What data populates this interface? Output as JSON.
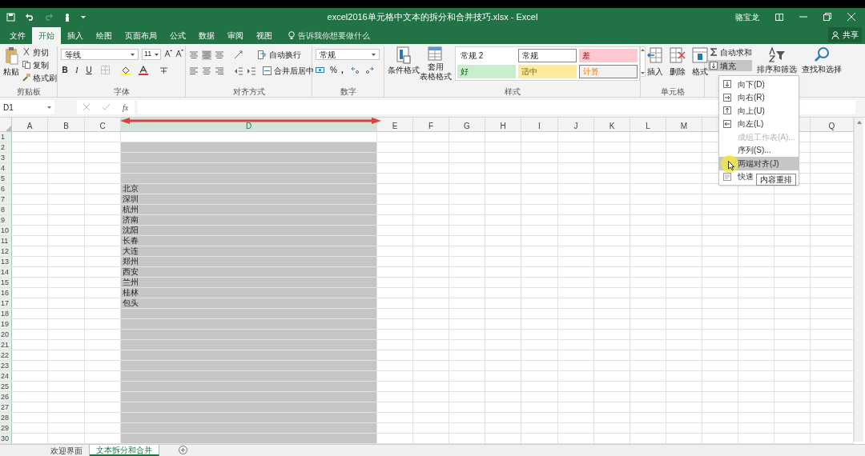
{
  "window": {
    "title": "excel2016单元格中文本的拆分和合并技巧.xlsx - Excel",
    "user": "骆宝龙"
  },
  "tabs": [
    {
      "label": "文件",
      "selected": false
    },
    {
      "label": "开始",
      "selected": true
    },
    {
      "label": "插入",
      "selected": false
    },
    {
      "label": "绘图",
      "selected": false
    },
    {
      "label": "页面布局",
      "selected": false
    },
    {
      "label": "公式",
      "selected": false
    },
    {
      "label": "数据",
      "selected": false
    },
    {
      "label": "审阅",
      "selected": false
    },
    {
      "label": "视图",
      "selected": false
    }
  ],
  "tell_me": {
    "placeholder": "告诉我你想要做什么"
  },
  "share_button": "共享",
  "ribbon": {
    "clipboard": {
      "paste": "粘贴",
      "cut": "剪切",
      "copy": "复制",
      "format_painter": "格式刷",
      "label": "剪贴板"
    },
    "font": {
      "font_name": "等线",
      "font_size": "11",
      "bold": "B",
      "italic": "I",
      "underline": "U",
      "label": "字体"
    },
    "alignment": {
      "wrap_text": "自动换行",
      "merge_center": "合并后居中",
      "label": "对齐方式"
    },
    "number": {
      "format": "常规",
      "percent": "%",
      "comma": ",",
      "label": "数字"
    },
    "styles": {
      "conditional_format": "条件格式",
      "table_format_line1": "套用",
      "table_format_line2": "表格格式",
      "label": "样式",
      "cells": [
        {
          "label": "常规 2",
          "kind": "normal2"
        },
        {
          "label": "常规",
          "kind": "normal"
        },
        {
          "label": "差",
          "kind": "bad"
        },
        {
          "label": "好",
          "kind": "good"
        },
        {
          "label": "适中",
          "kind": "neutral"
        },
        {
          "label": "计算",
          "kind": "calc"
        }
      ]
    },
    "cells": {
      "insert": "插入",
      "delete": "删除",
      "format": "格式",
      "label": "单元格"
    },
    "editing": {
      "autosum": "自动求和",
      "fill": "填充",
      "sort_filter": "排序和筛选",
      "find_select": "查找和选择"
    }
  },
  "formula_bar": {
    "name_box": "D1",
    "fx": "fx"
  },
  "columns": [
    {
      "label": "A",
      "selected": false
    },
    {
      "label": "B",
      "selected": false
    },
    {
      "label": "C",
      "selected": false
    },
    {
      "label": "D",
      "selected": true
    },
    {
      "label": "E",
      "selected": false
    },
    {
      "label": "F",
      "selected": false
    },
    {
      "label": "G",
      "selected": false
    },
    {
      "label": "H",
      "selected": false
    },
    {
      "label": "I",
      "selected": false
    },
    {
      "label": "J",
      "selected": false
    },
    {
      "label": "K",
      "selected": false
    },
    {
      "label": "L",
      "selected": false
    },
    {
      "label": "M",
      "selected": false
    },
    {},
    {},
    {},
    {
      "label": "Q",
      "selected": false
    }
  ],
  "rows": [
    {
      "header": "1"
    },
    {
      "header": "2"
    },
    {
      "header": "3"
    },
    {
      "header": "4"
    },
    {
      "header": "5"
    },
    {
      "header": "6",
      "d": "北京"
    },
    {
      "header": "7",
      "d": "深圳"
    },
    {
      "header": "8",
      "d": "杭州"
    },
    {
      "header": "9",
      "d": "济南"
    },
    {
      "header": "10",
      "d": "沈阳"
    },
    {
      "header": "11",
      "d": "长春"
    },
    {
      "header": "12",
      "d": "大连"
    },
    {
      "header": "13",
      "d": "郑州"
    },
    {
      "header": "14",
      "d": "西安"
    },
    {
      "header": "15",
      "d": "兰州"
    },
    {
      "header": "16",
      "d": "桂林"
    },
    {
      "header": "17",
      "d": "包头"
    },
    {
      "header": "18"
    },
    {
      "header": "19"
    },
    {
      "header": "20"
    },
    {
      "header": "21"
    },
    {
      "header": "22"
    },
    {
      "header": "23"
    },
    {
      "header": "24"
    },
    {
      "header": "25"
    },
    {
      "header": "26"
    },
    {
      "header": "27"
    },
    {
      "header": "28"
    },
    {
      "header": "29"
    },
    {
      "header": "30"
    }
  ],
  "fill_menu": [
    {
      "label": "向下(D)",
      "kind": "down",
      "disabled": false,
      "selected": false
    },
    {
      "label": "向右(R)",
      "kind": "right",
      "disabled": false,
      "selected": false
    },
    {
      "label": "向上(U)",
      "kind": "up",
      "disabled": false,
      "selected": false
    },
    {
      "label": "向左(L)",
      "kind": "left",
      "disabled": false,
      "selected": false
    },
    {
      "label": "成组工作表(A)...",
      "kind": "plain",
      "disabled": true,
      "selected": false
    },
    {
      "label": "序列(S)...",
      "kind": "plain",
      "disabled": false,
      "selected": false
    },
    {
      "label": "两端对齐(J)",
      "kind": "plain",
      "disabled": false,
      "selected": true
    },
    {
      "label": "快速",
      "kind": "flash",
      "disabled": false,
      "selected": false
    }
  ],
  "tooltip": "内容重排",
  "sheet_tabs": [
    {
      "label": "欢迎界面",
      "selected": false
    },
    {
      "label": "文本拆分和合并",
      "selected": true
    }
  ]
}
